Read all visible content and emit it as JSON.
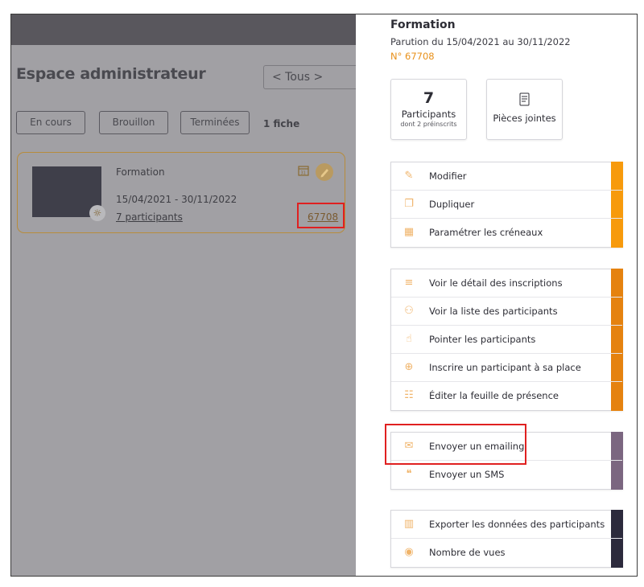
{
  "left": {
    "title": "Espace administrateur",
    "filter": {
      "value": "< Tous >"
    },
    "chips": [
      "En cours",
      "Brouillon",
      "Terminées"
    ],
    "fiche_count": "1 fiche",
    "card": {
      "title": "Formation",
      "dates": "15/04/2021 - 30/11/2022",
      "participants_link": "7 participants",
      "number": "67708"
    }
  },
  "panel": {
    "title": "Formation",
    "parution": "Parution du 15/04/2021 au 30/11/2022",
    "number": "N° 67708",
    "stats": {
      "participants": {
        "count": "7",
        "label": "Participants",
        "sub": "dont 2 préinscrits"
      },
      "attachments": {
        "label": "Pièces jointes"
      }
    },
    "groups": [
      {
        "color": "#f79a0c",
        "items": [
          {
            "label": "Modifier",
            "icon": "pencil-icon"
          },
          {
            "label": "Dupliquer",
            "icon": "duplicate-icon"
          },
          {
            "label": "Paramétrer les créneaux",
            "icon": "calendar-icon"
          }
        ]
      },
      {
        "color": "#e5820f",
        "items": [
          {
            "label": "Voir le détail des inscriptions",
            "icon": "list-icon"
          },
          {
            "label": "Voir la liste des participants",
            "icon": "people-icon"
          },
          {
            "label": "Pointer les participants",
            "icon": "hand-pointer-icon"
          },
          {
            "label": "Inscrire un participant à sa place",
            "icon": "plus-circle-icon"
          },
          {
            "label": "Éditer la feuille de présence",
            "icon": "checklist-icon"
          }
        ]
      },
      {
        "color": "#7b6680",
        "items": [
          {
            "label": "Envoyer un emailing",
            "icon": "envelope-icon"
          },
          {
            "label": "Envoyer un SMS",
            "icon": "chat-bubbles-icon"
          }
        ]
      },
      {
        "color": "#2c2a3c",
        "items": [
          {
            "label": "Exporter les données des participants",
            "icon": "bar-chart-icon"
          },
          {
            "label": "Nombre de vues",
            "icon": "eye-icon"
          }
        ]
      }
    ]
  }
}
